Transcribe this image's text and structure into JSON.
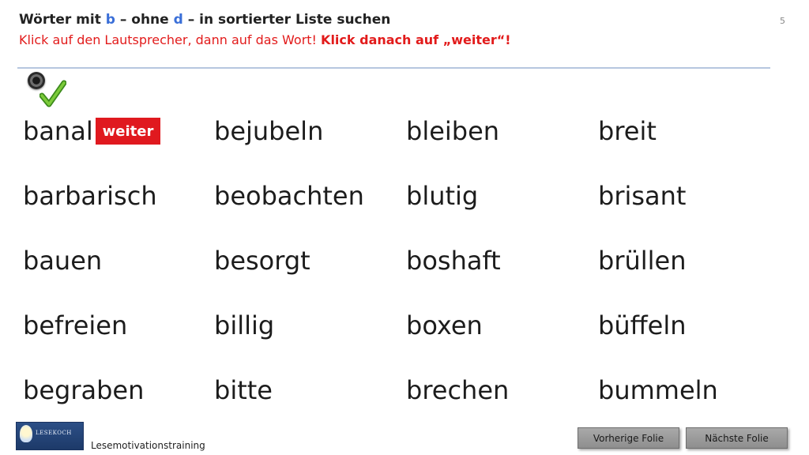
{
  "header": {
    "title_prefix": "Wörter mit ",
    "title_b": "b",
    "title_mid": " – ohne ",
    "title_d": "d",
    "title_suffix": " – in sortierter Liste suchen",
    "instruction": "Klick auf den Lautsprecher, dann auf das Wort! ",
    "instruction_bold": "Klick danach auf „weiter“!",
    "slide_number": "5",
    "accent_color": "#3a6fd8",
    "instruction_color": "#e21b1b"
  },
  "icons": {
    "speaker": "speaker-icon",
    "check": "checkmark-icon"
  },
  "words": {
    "col1": [
      "banal",
      "barbarisch",
      "bauen",
      "befreien",
      "begraben"
    ],
    "col2": [
      "bejubeln",
      "beobachten",
      "besorgt",
      "billig",
      "bitte"
    ],
    "col3": [
      "bleiben",
      "blutig",
      "boshaft",
      "boxen",
      "brechen"
    ],
    "col4": [
      "breit",
      "brisant",
      "brüllen",
      "büffeln",
      "bummeln"
    ]
  },
  "weiter_button": {
    "label": "weiter",
    "color": "#e0191f"
  },
  "footer": {
    "logo_text": "LESEKOCH",
    "label": "Lesemotivationstraining"
  },
  "nav": {
    "prev_label": "Vorherige  Folie",
    "next_label": "Nächste  Folie"
  }
}
